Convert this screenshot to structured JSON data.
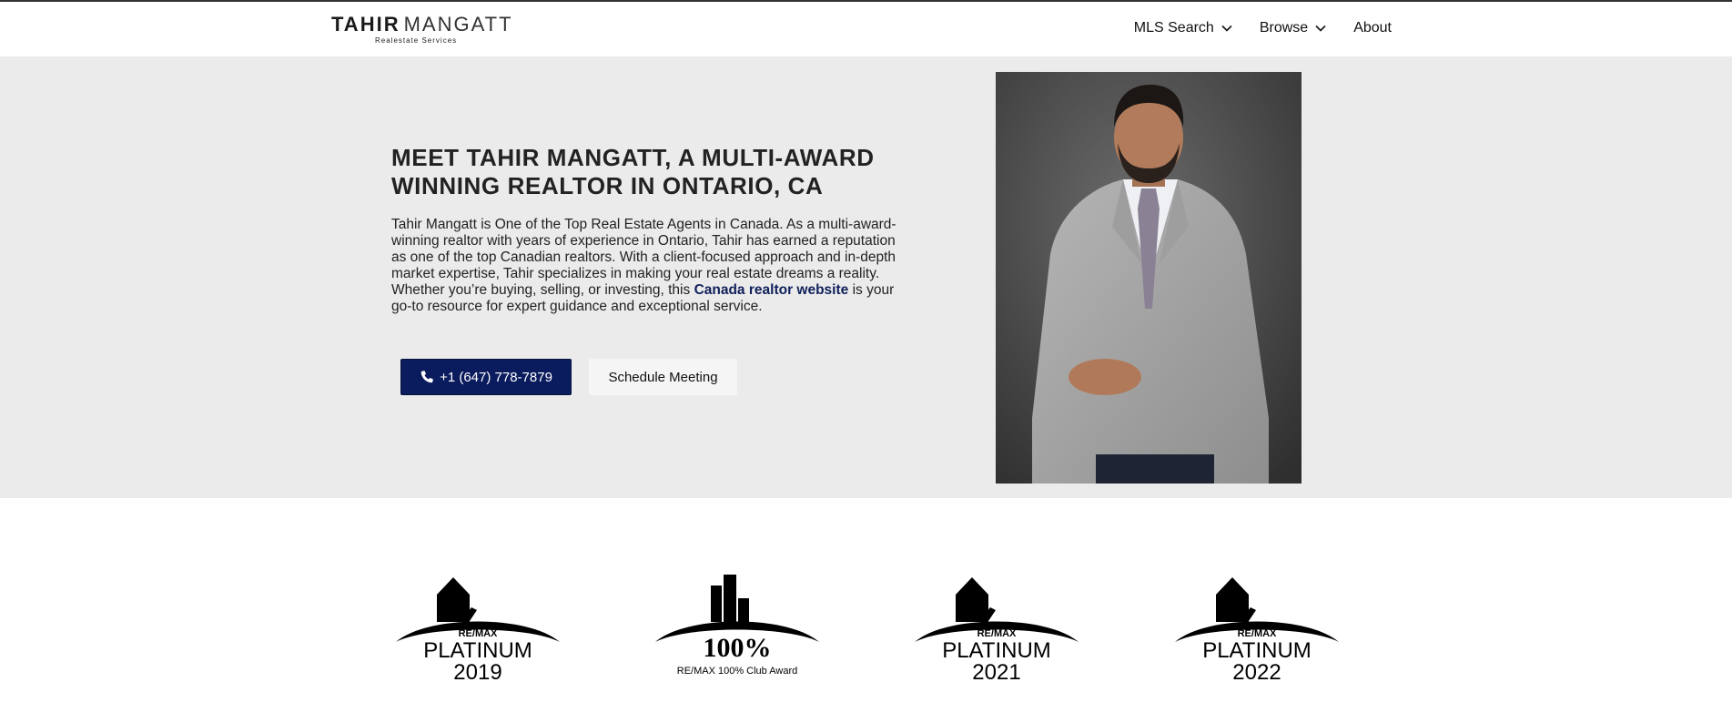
{
  "header": {
    "logo": {
      "bold": "TAHIR",
      "light": "MANGATT",
      "sub": "Realestate Services"
    },
    "nav": [
      {
        "label": "MLS Search",
        "dropdown": true
      },
      {
        "label": "Browse",
        "dropdown": true
      },
      {
        "label": "About",
        "dropdown": false
      }
    ]
  },
  "hero": {
    "title": "MEET TAHIR MANGATT, A MULTI-AWARD WINNING REALTOR IN ONTARIO, CA",
    "text_before": "Tahir Mangatt is One of the Top Real Estate Agents in Canada. As a multi-award-winning realtor with years of experience in Ontario, Tahir has earned a reputation as one of the top Canadian realtors. With a client-focused approach and in-depth market expertise, Tahir specializes in making your real estate dreams a reality. Whether you’re buying, selling, or investing, this ",
    "link_text": "Canada realtor website",
    "text_after": " is your go-to resource for expert guidance and exceptional service.",
    "phone_button": "+1 (647) 778-7879",
    "meeting_button": "Schedule Meeting"
  },
  "awards": [
    {
      "brand": "RE/MAX",
      "title": "PLATINUM",
      "year": "2019"
    },
    {
      "title": "100%",
      "caption": "RE/MAX 100% Club Award"
    },
    {
      "brand": "RE/MAX",
      "title": "PLATINUM",
      "year": "2021"
    },
    {
      "brand": "RE/MAX",
      "title": "PLATINUM",
      "year": "2022"
    }
  ],
  "colors": {
    "primary": "#0b1c5e",
    "hero_bg": "#ebebeb",
    "link": "#10205a"
  }
}
